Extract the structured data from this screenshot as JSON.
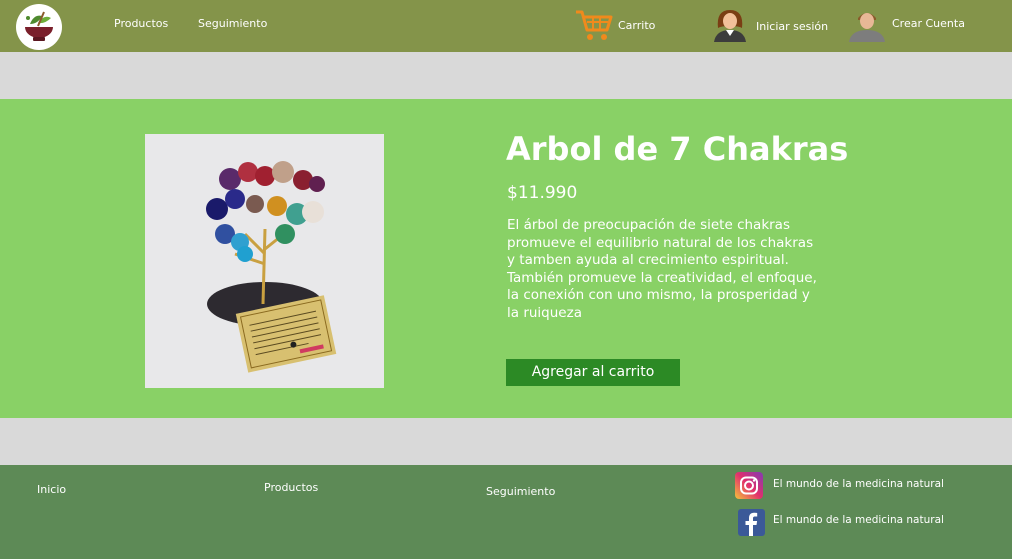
{
  "header": {
    "nav": {
      "productos": "Productos",
      "seguimiento": "Seguimiento"
    },
    "cart_label": "Carrito",
    "login_label": "Iniciar sesión",
    "signup_label": "Crear Cuenta",
    "icons": [
      "logo-mortar-icon",
      "cart-icon",
      "female-avatar-icon",
      "male-avatar-icon"
    ]
  },
  "product": {
    "title": "Arbol de 7 Chakras",
    "price": "$11.990",
    "description_1": "El árbol de preocupación de siete chakras promueve el equilibrio natural de los chakras y tamben ayuda al crecimiento espiritual.",
    "description_2": "También promueve la creatividad, el enfoque, la conexión con uno mismo, la prosperidad y la ruiqueza",
    "add_to_cart": "Agregar al carrito"
  },
  "footer": {
    "links": {
      "inicio": "Inicio",
      "productos": "Productos",
      "seguimiento": "Seguimiento"
    },
    "instagram_label": "El mundo de la medicina natural",
    "facebook_label": "El mundo de la medicina natural"
  },
  "colors": {
    "header_bg": "#84944a",
    "product_bg": "#89d166",
    "button_bg": "#2c8a25",
    "footer_bg": "#5d8a56",
    "page_bg": "#d9d9d9"
  }
}
